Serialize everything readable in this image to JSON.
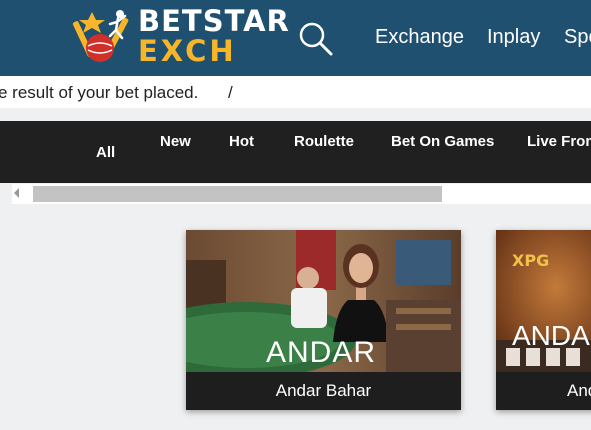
{
  "header": {
    "logo_top": "BETSTAR",
    "logo_bottom": "EXCH",
    "search_icon": "search-icon",
    "nav": [
      "Exchange",
      "Inplay",
      "Spo"
    ]
  },
  "marquee": {
    "text": "e result of your bet placed.",
    "separator": "/"
  },
  "categories": [
    "All",
    "New",
    "Hot",
    "Roulette",
    "Bet On Games",
    "Live From"
  ],
  "games": [
    {
      "overlay": "ANDAR",
      "caption": "Andar Bahar"
    },
    {
      "overlay": "ANDAR",
      "brand": "XPG",
      "caption": "And"
    }
  ],
  "colors": {
    "header_bg": "#1f5070",
    "logo_accent": "#f7b52a",
    "category_bar": "#202020",
    "page_bg": "#eef0f1"
  }
}
